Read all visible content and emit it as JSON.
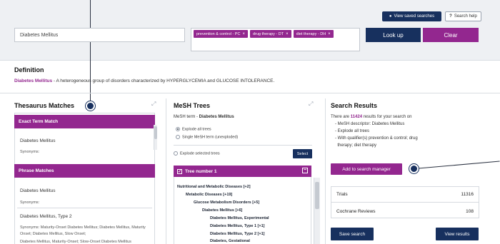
{
  "header": {
    "view_saved_searches": "View saved searches",
    "search_help": "Search help",
    "search_value": "Diabetes Mellitus",
    "qualifiers": [
      "prevention & control - PC",
      "drug therapy - DT",
      "diet therapy - DH"
    ],
    "lookup_label": "Look up",
    "clear_label": "Clear",
    "chip_remove": "×",
    "help_glyph": "?"
  },
  "definition": {
    "title": "Definition",
    "term": "Diabetes Mellitus",
    "text": " - A heterogeneous group of disorders characterized by HYPERGLYCEMIA and GLUCOSE INTOLERANCE."
  },
  "thesaurus": {
    "title": "Thesaurus Matches",
    "exact_header": "Exact Term Match",
    "exact_term": "Diabetes Mellitus",
    "exact_synonyms_label": "Synonyms:",
    "phrase_header": "Phrase Matches",
    "phrase_items": [
      {
        "term": "Diabetes Mellitus",
        "synonyms": "Synonyms:"
      },
      {
        "term": "Diabetes Mellitus, Type 2",
        "synonyms": "Synonyms: Maturity-Onset Diabetes Mellitus; Diabetes Mellitus, Maturity Onset; Diabetes Mellitus, Slow Onset;"
      }
    ],
    "cut_text": "Diabetes Mellitus, Maturity-Onset; Slow-Onset Diabetes Mellitus"
  },
  "mesh": {
    "title": "MeSH Trees",
    "term_prefix": "MeSH term - ",
    "term": "Diabetes Mellitus",
    "options": [
      {
        "label": "Explode all trees",
        "selected": true
      },
      {
        "label": "Single MeSH term (unexploded)",
        "selected": false
      }
    ],
    "explode_selected": "Explode selected trees",
    "select_label": "Select",
    "tree_header": "Tree number 1",
    "tree_items": [
      "Nutritional and Metabolic Diseases [+2]",
      "Metabolic Diseases [+19]",
      "Glucose Metabolism Disorders [+5]",
      "Diabetes Mellitus [+6]",
      "Diabetes Mellitus, Experimental",
      "Diabetes Mellitus, Type 1 [+1]",
      "Diabetes Mellitus, Type 2 [+1]",
      "Diabetes, Gestational"
    ]
  },
  "results": {
    "title": "Search Results",
    "line1_pre": "There are ",
    "count": "11424",
    "line1_post": " results for your search on",
    "bullets": [
      "- MeSH descriptor: Diabetes Mellitus",
      "- Explode all trees",
      "- With qualifier(s) prevention & control; drug",
      "  therapy; diet therapy"
    ],
    "add_label": "Add to search manager",
    "rows": [
      {
        "label": "Trials",
        "value": "11316"
      },
      {
        "label": "Cochrane Reviews",
        "value": "108"
      }
    ],
    "save_label": "Save search",
    "view_label": "View results"
  },
  "colors": {
    "navy": "#17305e",
    "magenta": "#93278f"
  }
}
